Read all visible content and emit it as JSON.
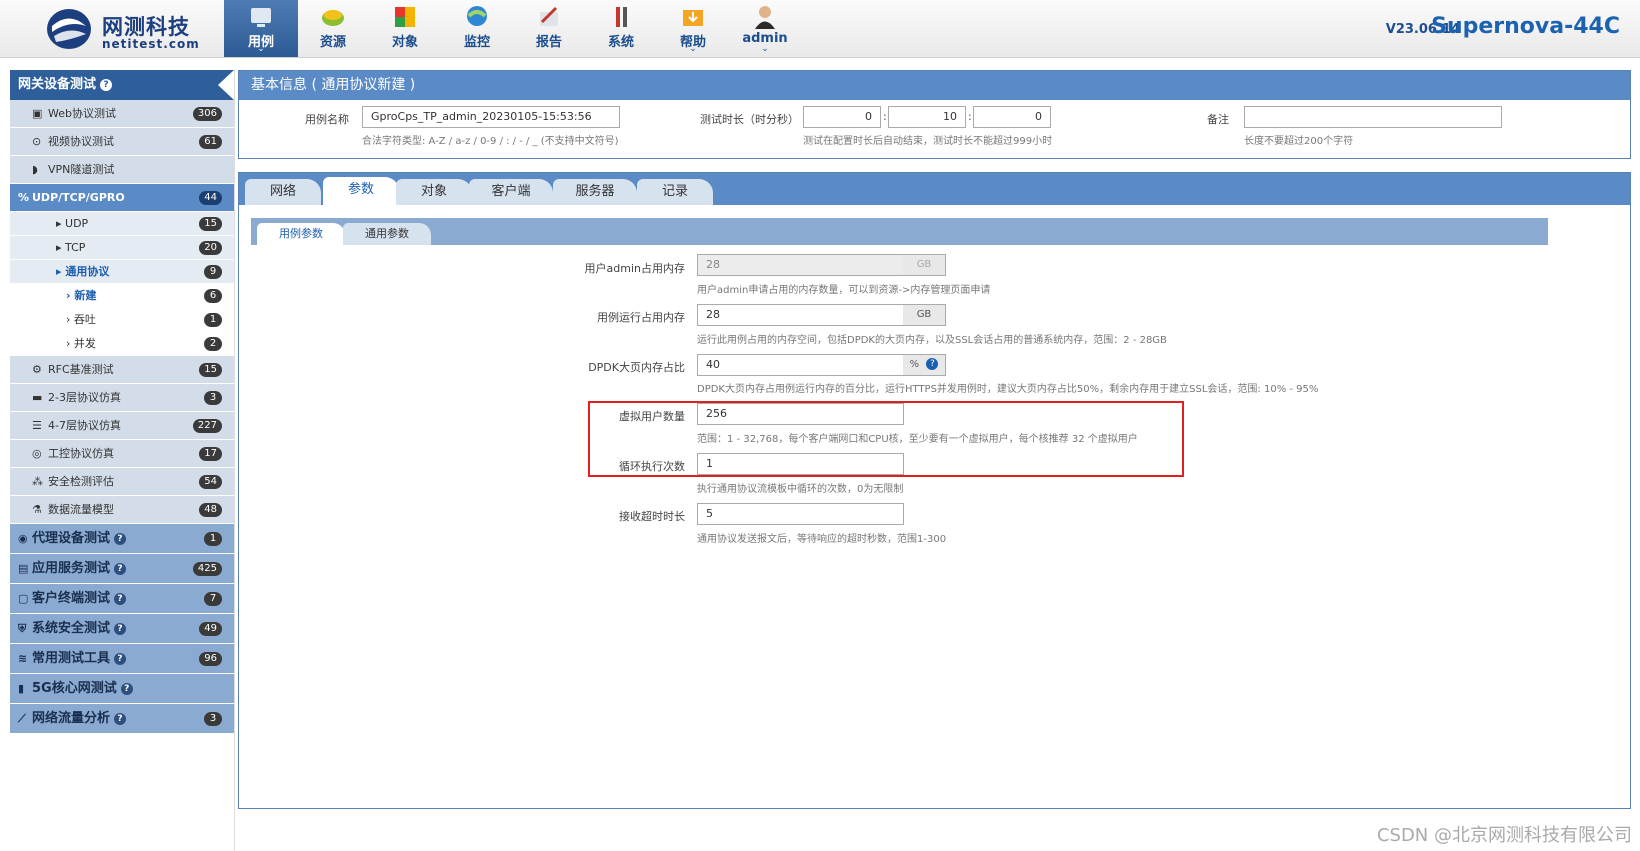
{
  "brand": {
    "name": "网测科技",
    "domain": "netitest.com"
  },
  "nav": [
    {
      "label": "用例",
      "icon": "case-icon",
      "dropdown": true
    },
    {
      "label": "资源",
      "icon": "resource-icon"
    },
    {
      "label": "对象",
      "icon": "object-icon"
    },
    {
      "label": "监控",
      "icon": "monitor-icon"
    },
    {
      "label": "报告",
      "icon": "report-icon"
    },
    {
      "label": "系统",
      "icon": "system-icon"
    },
    {
      "label": "帮助",
      "icon": "help-icon",
      "dropdown": true
    },
    {
      "label": "admin",
      "icon": "user-icon",
      "dropdown": true
    }
  ],
  "version": "V23.06.14",
  "product": "Supernova-44C",
  "sidebar": {
    "head": "网关设备测试",
    "items": [
      {
        "label": "Web协议测试",
        "count": "306"
      },
      {
        "label": "视频协议测试",
        "count": "61"
      },
      {
        "label": "VPN隧道测试",
        "count": ""
      },
      {
        "label": "UDP/TCP/GPRO",
        "count": "44"
      },
      {
        "label": "UDP",
        "count": "15"
      },
      {
        "label": "TCP",
        "count": "20"
      },
      {
        "label": "通用协议",
        "count": "9"
      },
      {
        "label": "新建",
        "count": "6"
      },
      {
        "label": "吞吐",
        "count": "1"
      },
      {
        "label": "并发",
        "count": "2"
      },
      {
        "label": "RFC基准测试",
        "count": "15"
      },
      {
        "label": "2-3层协议仿真",
        "count": "3"
      },
      {
        "label": "4-7层协议仿真",
        "count": "227"
      },
      {
        "label": "工控协议仿真",
        "count": "17"
      },
      {
        "label": "安全检测评估",
        "count": "54"
      },
      {
        "label": "数据流量模型",
        "count": "48"
      }
    ],
    "groups": [
      {
        "label": "代理设备测试",
        "count": "1"
      },
      {
        "label": "应用服务测试",
        "count": "425"
      },
      {
        "label": "客户终端测试",
        "count": "7"
      },
      {
        "label": "系统安全测试",
        "count": "49"
      },
      {
        "label": "常用测试工具",
        "count": "96"
      },
      {
        "label": "5G核心网测试",
        "count": ""
      },
      {
        "label": "网络流量分析",
        "count": "3"
      }
    ]
  },
  "basic": {
    "title": "基本信息 ( 通用协议新建 )",
    "case_name_label": "用例名称",
    "case_name": "GproCps_TP_admin_20230105-15:53:56",
    "case_name_hint": "合法字符类型: A-Z / a-z / 0-9 / : / - / _ (不支持中文符号)",
    "duration_label": "测试时长（时分秒）",
    "h": "0",
    "m": "10",
    "s": "0",
    "duration_hint": "测试在配置时长后自动结束，测试时长不能超过999小时",
    "remark_label": "备注",
    "remark": "",
    "remark_hint": "长度不要超过200个字符"
  },
  "tabs": [
    "网络",
    "参数",
    "对象",
    "客户端",
    "服务器",
    "记录"
  ],
  "subtabs": [
    "用例参数",
    "通用参数"
  ],
  "params": [
    {
      "label": "用户admin占用内存",
      "value": "28",
      "unit": "GB",
      "hint": "用户admin申请占用的内存数量，可以到资源->内存管理页面申请"
    },
    {
      "label": "用例运行占用内存",
      "value": "28",
      "unit": "GB",
      "hint": "运行此用例占用的内存空间，包括DPDK的大页内存，以及SSL会话占用的普通系统内存，范围：2 - 28GB"
    },
    {
      "label": "DPDK大页内存占比",
      "value": "40",
      "unit": "%",
      "hint": "DPDK大页内存占用例运行内存的百分比，运行HTTPS并发用例时，建议大页内存占比50%，剩余内存用于建立SSL会话，范围: 10% - 95%"
    },
    {
      "label": "虚拟用户数量",
      "value": "256",
      "hint": "范围：1 - 32,768，每个客户端网口和CPU核，至少要有一个虚拟用户，每个核推荐 32 个虚拟用户"
    },
    {
      "label": "循环执行次数",
      "value": "1",
      "hint": "执行通用协议流模板中循环的次数，0为无限制"
    },
    {
      "label": "接收超时时长",
      "value": "5",
      "hint": "通用协议发送报文后，等待响应的超时秒数，范围1-300"
    }
  ],
  "watermark": "CSDN @北京网测科技有限公司"
}
